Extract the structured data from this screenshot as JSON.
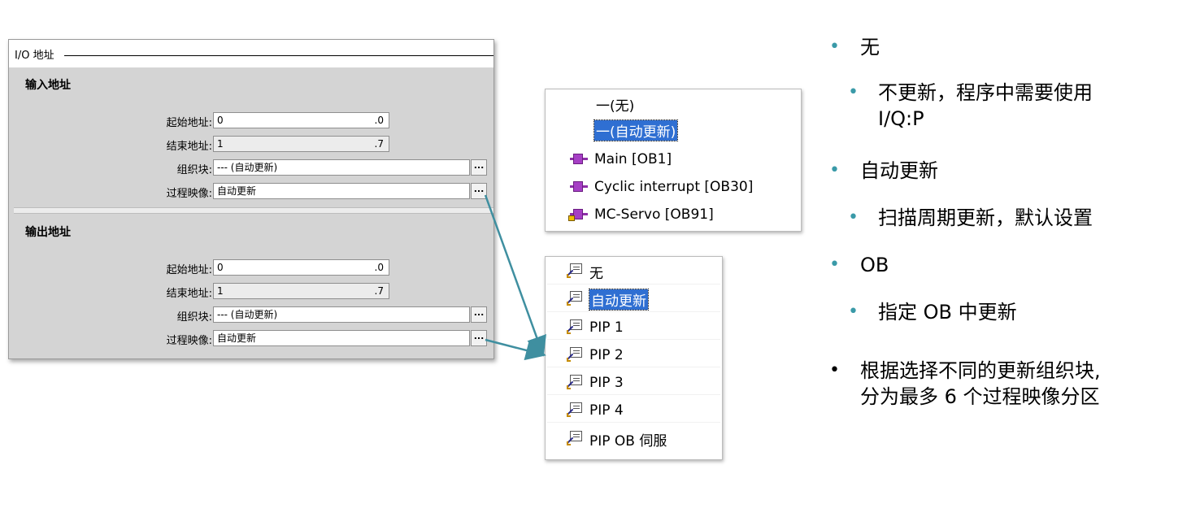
{
  "io_panel": {
    "header": "I/O 地址",
    "input": {
      "title": "输入地址",
      "start_label": "起始地址:",
      "start_value": "0",
      "start_suffix": ".0",
      "end_label": "结束地址:",
      "end_value": "1",
      "end_suffix": ".7",
      "ob_label": "组织块:",
      "ob_value": "--- (自动更新)",
      "pi_label": "过程映像:",
      "pi_value": "自动更新",
      "button_label": "..."
    },
    "output": {
      "title": "输出地址",
      "start_label": "起始地址:",
      "start_value": "0",
      "start_suffix": ".0",
      "end_label": "结束地址:",
      "end_value": "1",
      "end_suffix": ".7",
      "ob_label": "组织块:",
      "ob_value": "--- (自动更新)",
      "pi_label": "过程映像:",
      "pi_value": "自动更新",
      "button_label": "..."
    }
  },
  "ob_dropdown": {
    "items": [
      {
        "label": "一(无)"
      },
      {
        "label": "一(自动更新)",
        "selected": true
      },
      {
        "label": "Main [OB1]",
        "icon": "ob-block-icon"
      },
      {
        "label": "Cyclic interrupt [OB30]",
        "icon": "ob-block-icon"
      },
      {
        "label": "MC-Servo [OB91]",
        "icon": "ob-block-locked-icon"
      }
    ]
  },
  "pip_dropdown": {
    "items": [
      {
        "label": "无",
        "icon": "process-image-icon"
      },
      {
        "label": "自动更新",
        "icon": "process-image-icon",
        "selected": true
      },
      {
        "label": "PIP 1",
        "icon": "process-image-icon"
      },
      {
        "label": "PIP 2",
        "icon": "process-image-icon"
      },
      {
        "label": "PIP 3",
        "icon": "process-image-icon"
      },
      {
        "label": "PIP 4",
        "icon": "process-image-icon"
      },
      {
        "label": "PIP OB 伺服",
        "icon": "process-image-icon"
      }
    ]
  },
  "bullets": {
    "b1": "无",
    "b1a": "不更新，程序中需要使用",
    "b1a_line2": "I/Q:P",
    "b2": "自动更新",
    "b2a": "扫描周期更新，默认设置",
    "b3": "OB",
    "b3a": "指定 OB 中更新",
    "b4": "根据选择不同的更新组织块,",
    "b4_line2": "分为最多 6 个过程映像分区"
  },
  "colors": {
    "accent_bullet": "#3a9aa8",
    "arrow": "#3f8fa0",
    "selection": "#2f6fd2",
    "ob_icon": "#a63fc5"
  }
}
